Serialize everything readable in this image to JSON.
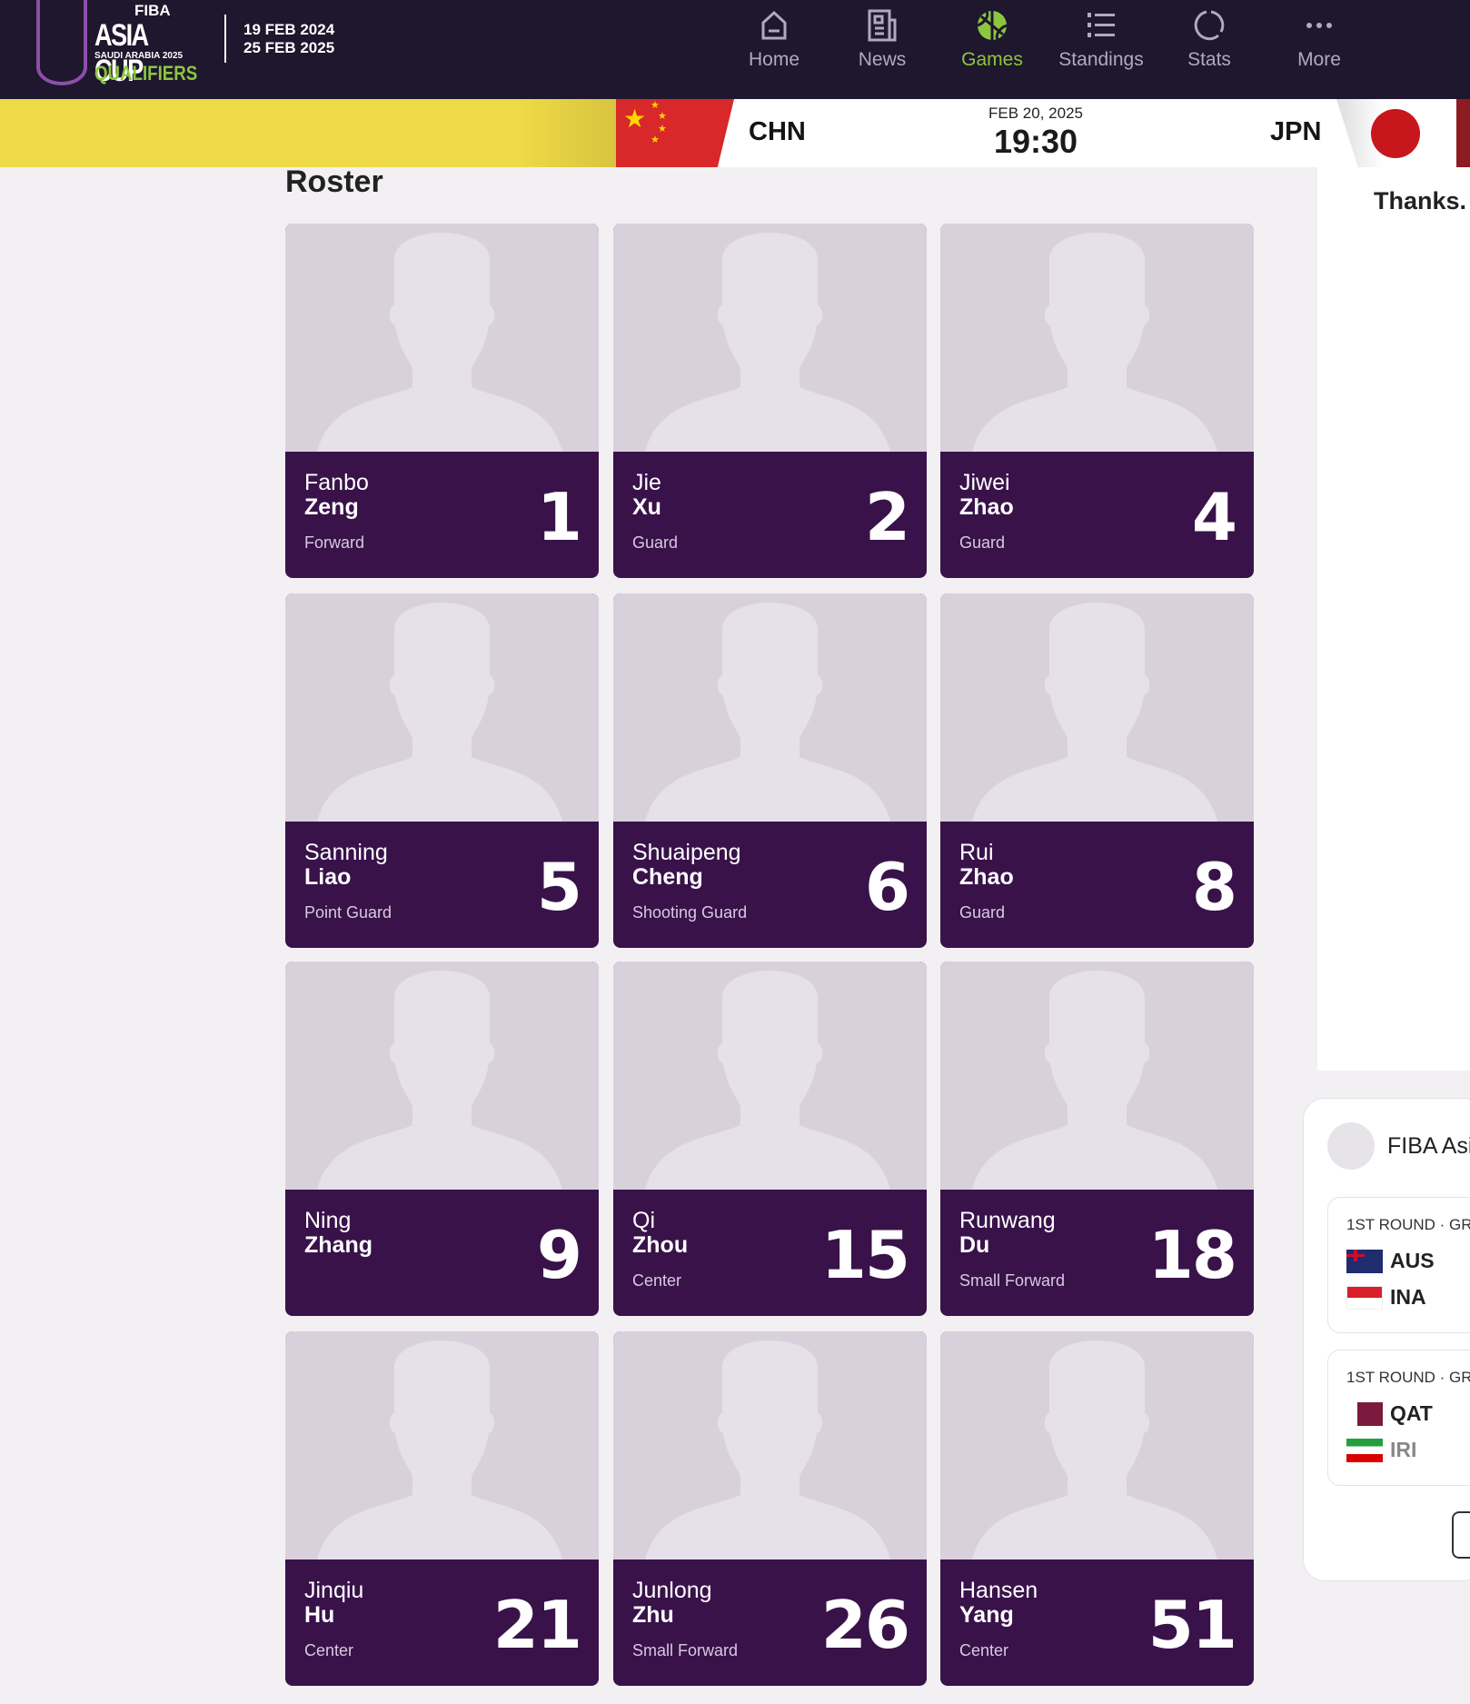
{
  "header": {
    "logo": {
      "fiba": "FIBA",
      "title": "ASIA CUP",
      "subtitle": "SAUDI ARABIA 2025",
      "qualifiers": "QUALIFIERS"
    },
    "dates": [
      "19 FEB 2024",
      "25 FEB 2025"
    ],
    "nav": [
      {
        "label": "Home",
        "icon": "home-icon"
      },
      {
        "label": "News",
        "icon": "newspaper-icon"
      },
      {
        "label": "Games",
        "icon": "basketball-icon",
        "active": true
      },
      {
        "label": "Standings",
        "icon": "ranked-list-icon"
      },
      {
        "label": "Stats",
        "icon": "stats-ring-icon"
      },
      {
        "label": "More",
        "icon": "more-dots-icon"
      }
    ]
  },
  "match": {
    "home": "CHN",
    "away": "JPN",
    "date": "FEB 20, 2025",
    "time": "19:30"
  },
  "roster": {
    "title": "Roster",
    "players": [
      {
        "first": "Fanbo",
        "last": "Zeng",
        "position": "Forward",
        "number": "1"
      },
      {
        "first": "Jie",
        "last": "Xu",
        "position": "Guard",
        "number": "2"
      },
      {
        "first": "Jiwei",
        "last": "Zhao",
        "position": "Guard",
        "number": "4"
      },
      {
        "first": "Sanning",
        "last": "Liao",
        "position": "Point Guard",
        "number": "5"
      },
      {
        "first": "Shuaipeng",
        "last": "Cheng",
        "position": "Shooting Guard",
        "number": "6"
      },
      {
        "first": "Rui",
        "last": "Zhao",
        "position": "Guard",
        "number": "8"
      },
      {
        "first": "Ning",
        "last": "Zhang",
        "position": "",
        "number": "9"
      },
      {
        "first": "Qi",
        "last": "Zhou",
        "position": "Center",
        "number": "15"
      },
      {
        "first": "Runwang",
        "last": "Du",
        "position": "Small Forward",
        "number": "18"
      },
      {
        "first": "Jinqiu",
        "last": "Hu",
        "position": "Center",
        "number": "21"
      },
      {
        "first": "Junlong",
        "last": "Zhu",
        "position": "Small Forward",
        "number": "26"
      },
      {
        "first": "Hansen",
        "last": "Yang",
        "position": "Center",
        "number": "51"
      }
    ]
  },
  "sidebar": {
    "thanks": "Thanks.",
    "widget_title": "FIBA Asi",
    "games": [
      {
        "round": "1ST ROUND · GR",
        "teams": [
          "AUS",
          "INA"
        ]
      },
      {
        "round": "1ST ROUND · GR",
        "teams": [
          "QAT",
          "IRI"
        ]
      }
    ]
  },
  "colors": {
    "header_bg": "#1e172d",
    "accent": "#8cc63f",
    "card_bg": "#39124a"
  }
}
